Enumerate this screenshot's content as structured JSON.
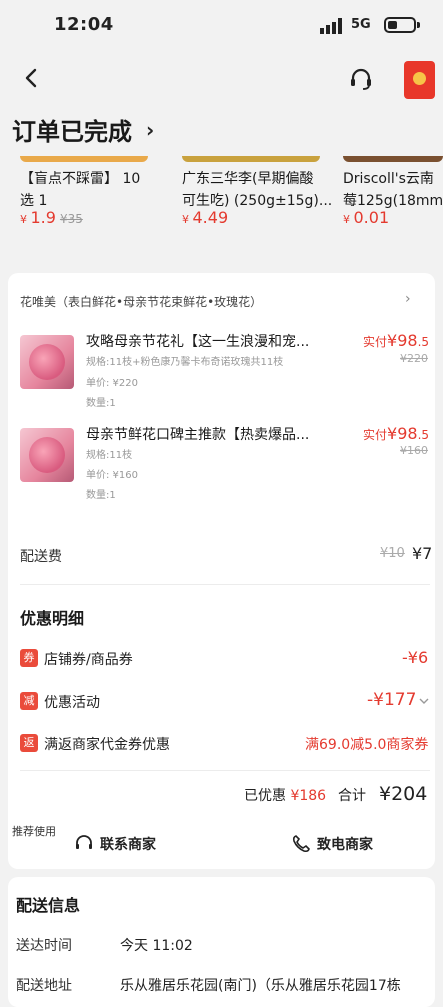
{
  "status_bar": {
    "time": "12:04",
    "network": "5G",
    "network_sub": "0 ⁸"
  },
  "header": {
    "title": "订单已完成",
    "title_chevron": "›"
  },
  "recommendations": [
    {
      "name_line1": "【盲点不踩雷】 10",
      "name_line2": "选 1",
      "price": "1.9",
      "orig_price": "¥35"
    },
    {
      "name_line1": "广东三华李(早期偏酸",
      "name_line2": "可生吃) (250g±15g)...",
      "price": "4.49",
      "orig_price": ""
    },
    {
      "name_line1": "Driscoll's云南",
      "name_line2": "莓125g(18mm)",
      "price": "0.01",
      "orig_price": ""
    }
  ],
  "shop": {
    "name": "花唯美（表白鲜花•母亲节花束鲜花•玫瑰花）",
    "chevron": "›"
  },
  "products": [
    {
      "name": "攻略母亲节花礼【这一生浪漫和宠...",
      "spec": "规格:11枝+粉色康乃馨卡布奇诺玫瑰共11枝",
      "unit_price": "单价: ¥220",
      "qty": "数量:1",
      "paid_label": "实付",
      "paid_int": "¥98",
      "paid_dec": ".5",
      "orig": "¥220"
    },
    {
      "name": "母亲节鲜花口碑主推款【热卖爆品...",
      "spec": "规格:11枝",
      "unit_price": "单价: ¥160",
      "qty": "数量:1",
      "paid_label": "实付",
      "paid_int": "¥98",
      "paid_dec": ".5",
      "orig": "¥160"
    }
  ],
  "shipping": {
    "label": "配送费",
    "orig": "¥10",
    "now": "¥7"
  },
  "discount": {
    "title": "优惠明细",
    "items": [
      {
        "tag": "券",
        "label": "店铺券/商品券",
        "value": "-¥6"
      },
      {
        "tag": "减",
        "label": "优惠活动",
        "value": "-¥177"
      },
      {
        "tag": "返",
        "label": "满返商家代金券优惠",
        "value": "满69.0减5.0商家券"
      }
    ]
  },
  "summary": {
    "saved_label": "已优惠",
    "saved_value": "¥186",
    "total_label": "合计",
    "total_value": "¥204"
  },
  "actions": {
    "recommend_label": "推荐使用",
    "contact": "联系商家",
    "call": "致电商家"
  },
  "delivery": {
    "title": "配送信息",
    "time_label": "送达时间",
    "time_value": "今天 11:02",
    "addr_label": "配送地址",
    "addr_value": "乐从雅居乐花园(南门)（乐从雅居乐花园17栋"
  },
  "colors": {
    "accent_red": "#e43a2f",
    "tag_red": "#ea4b3b",
    "background": "#f2f2f2"
  }
}
